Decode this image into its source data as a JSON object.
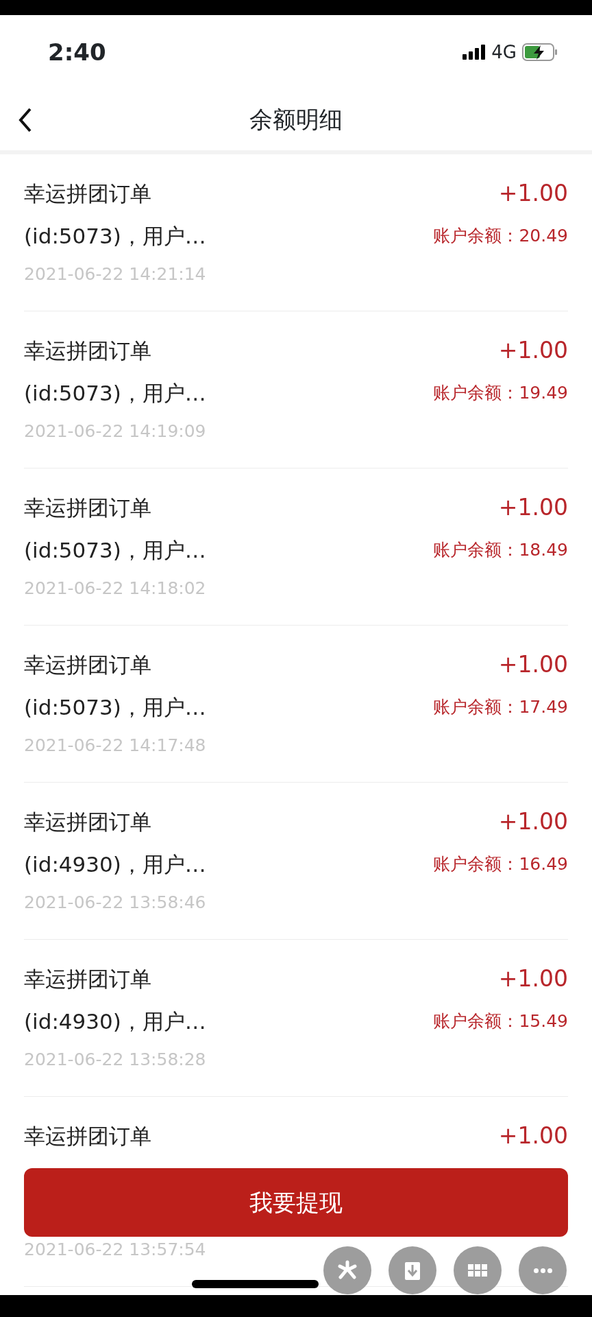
{
  "status_bar": {
    "time": "2:40",
    "network": "4G"
  },
  "header": {
    "title": "余额明细"
  },
  "records": [
    {
      "title": "幸运拼团订单",
      "detail": "(id:5073)，用户…",
      "time": "2021-06-22 14:21:14",
      "amount": "+1.00",
      "balance": "账户余额：20.49"
    },
    {
      "title": "幸运拼团订单",
      "detail": "(id:5073)，用户…",
      "time": "2021-06-22 14:19:09",
      "amount": "+1.00",
      "balance": "账户余额：19.49"
    },
    {
      "title": "幸运拼团订单",
      "detail": "(id:5073)，用户…",
      "time": "2021-06-22 14:18:02",
      "amount": "+1.00",
      "balance": "账户余额：18.49"
    },
    {
      "title": "幸运拼团订单",
      "detail": "(id:5073)，用户…",
      "time": "2021-06-22 14:17:48",
      "amount": "+1.00",
      "balance": "账户余额：17.49"
    },
    {
      "title": "幸运拼团订单",
      "detail": "(id:4930)，用户…",
      "time": "2021-06-22 13:58:46",
      "amount": "+1.00",
      "balance": "账户余额：16.49"
    },
    {
      "title": "幸运拼团订单",
      "detail": "(id:4930)，用户…",
      "time": "2021-06-22 13:58:28",
      "amount": "+1.00",
      "balance": "账户余额：15.49"
    },
    {
      "title": "幸运拼团订单",
      "time": "2021-06-22 13:57:54",
      "amount": "+1.00"
    }
  ],
  "withdraw_button": {
    "label": "我要提现"
  },
  "floating_actions": [
    {
      "kind": "asterisk"
    },
    {
      "kind": "download"
    },
    {
      "kind": "grid"
    },
    {
      "kind": "more"
    }
  ]
}
